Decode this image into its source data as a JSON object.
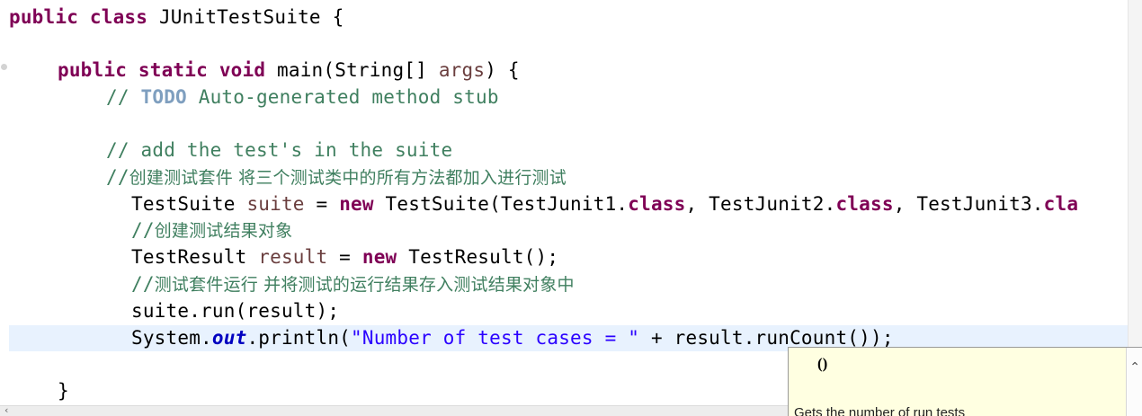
{
  "code": {
    "line1": {
      "kw1": "public",
      "kw2": "class",
      "rest": "JUnitTestSuite {"
    },
    "line2": {
      "kw1": "public",
      "kw2": "static",
      "kw3": "void",
      "sig": "main(String[] ",
      "param": "args",
      "tail": ") {"
    },
    "line3": {
      "slashes": "// ",
      "todo": "TODO",
      "rest": " Auto-generated method stub"
    },
    "line4": {
      "comment": "// add the test's in the suite"
    },
    "line5": {
      "slashes": "//",
      "cjk": "创建测试套件 将三个测试类中的所有方法都加入进行测试"
    },
    "line6": {
      "t1": "TestSuite ",
      "var": "suite",
      "t2": " = ",
      "kw_new": "new",
      "t3": " TestSuite(TestJunit1.",
      "kw_c1": "class",
      "t4": ", TestJunit2.",
      "kw_c2": "class",
      "t5": ", TestJunit3.",
      "kw_c3": "cla"
    },
    "line7": {
      "slashes": "//",
      "cjk": "创建测试结果对象"
    },
    "line8": {
      "t1": "TestResult ",
      "var": "result",
      "t2": " = ",
      "kw_new": "new",
      "t3": " TestResult();"
    },
    "line9": {
      "slashes": "//",
      "cjk": "测试套件运行 并将测试的运行结果存入测试结果对象中"
    },
    "line10": {
      "text": "suite.run(result);"
    },
    "line11": {
      "t1": "System.",
      "field": "out",
      "t2": ".println(",
      "str": "\"Number of test cases = \"",
      "t3": " + result.runCount());"
    },
    "line12": {
      "text": "}"
    }
  },
  "popup": {
    "signature": "()",
    "doc": "Gets the number of run tests"
  },
  "colors": {
    "keyword": "#7f0055",
    "comment": "#3f7f5f",
    "todo": "#7f9fbf",
    "string": "#2a00ff",
    "static_field": "#0000c0",
    "current_line": "#e8f2fe",
    "popup_bg": "#ffffe1"
  },
  "icons": {
    "hscroll_left": "chevron-left-icon",
    "popup_up": "chevron-up-icon"
  }
}
